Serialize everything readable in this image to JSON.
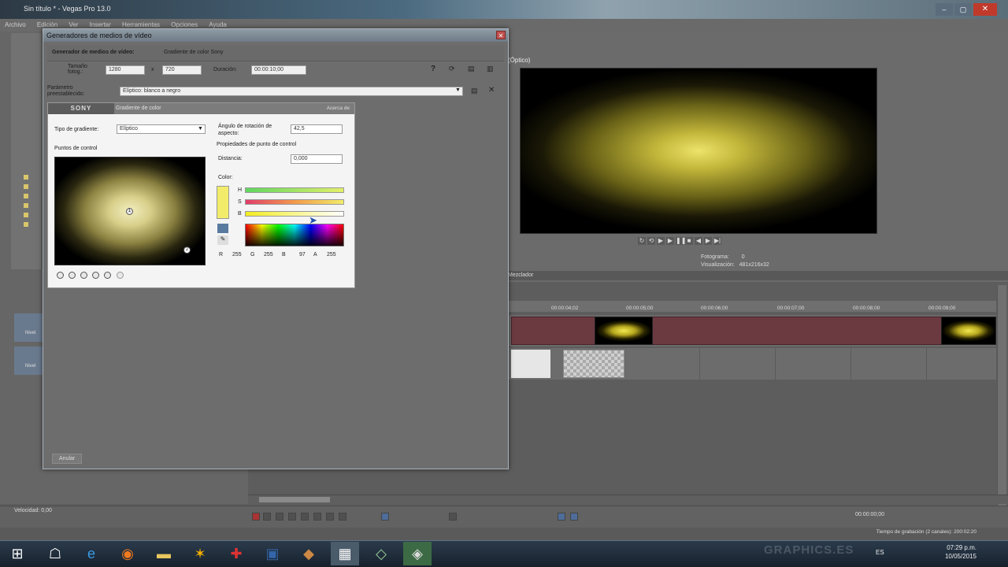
{
  "app": {
    "window_title": "Sin título * - Vegas Pro 13.0",
    "menu": [
      "Archivo",
      "Edición",
      "Ver",
      "Insertar",
      "Herramientas",
      "Opciones",
      "Ayuda"
    ]
  },
  "preview": {
    "mode": "(Óptico)",
    "info_labels": [
      "Fotograma:",
      "Visualización:"
    ],
    "info_values": [
      "0",
      "481x216x32"
    ]
  },
  "timeline": {
    "header": "Mezclador",
    "ruler_ticks": [
      "00:00:04;02",
      "00:00:05;00",
      "00:00:06;00",
      "00:00:07;00",
      "00:00:08;00",
      "00:00:09;00"
    ],
    "track_labels": [
      "Nivel",
      "Nivel"
    ],
    "velocity": "Velocidad: 0,00",
    "timecode": "00:00:00;00",
    "status": "Tiempo de grabación (2 canales): 200:02:20"
  },
  "dialog": {
    "title": "Generadores de medios de vídeo",
    "generator_label": "Generador de medios de vídeo:",
    "generator_value": "Gradiente de color Sony",
    "size_label": "Tamaño fotog.:",
    "width": "1280",
    "times": "x",
    "height": "720",
    "duration_label": "Duración:",
    "duration": "00:00:10;00",
    "preset_label": "Parámetro preestablecido:",
    "preset_value": "Elíptico: blanco a negro",
    "reset_button": "Anular"
  },
  "plugin": {
    "brand": "SONY",
    "name": "Gradiente de color",
    "about": "Acerca de",
    "gradient_type_label": "Tipo de gradiente:",
    "gradient_type_value": "Elíptico",
    "aspect_label": "Ángulo de rotación de aspecto:",
    "aspect_value": "42,5",
    "control_points_label": "Puntos de control",
    "point_props_label": "Propiedades de punto de control",
    "distance_label": "Distancia:",
    "distance_value": "0,000",
    "color_label": "Color:",
    "rgba_labels": [
      "R",
      "G",
      "B",
      "A"
    ],
    "rgba_values": [
      "255",
      "255",
      "97",
      "255"
    ],
    "channel_letters": [
      "H",
      "S",
      "B"
    ],
    "point_index": "1",
    "point_index_2": "2"
  },
  "taskbar": {
    "time": "07:29 p.m.",
    "date": "10/05/2015",
    "lang": "ES"
  },
  "watermark": "GRAPHICS.ES",
  "colors": {
    "accent_yellow": "#f2ec6a",
    "clip_red": "#6b3a40",
    "taskbar": "#1f2b36"
  }
}
